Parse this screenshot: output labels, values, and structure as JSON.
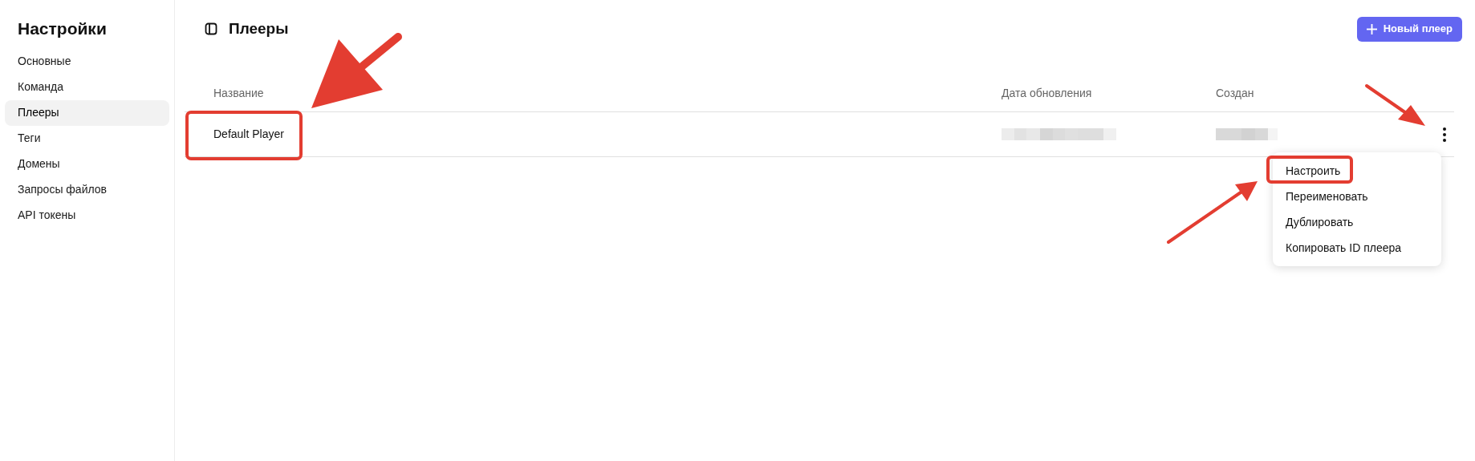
{
  "sidebar": {
    "title": "Настройки",
    "items": [
      {
        "label": "Основные",
        "selected": false
      },
      {
        "label": "Команда",
        "selected": false
      },
      {
        "label": "Плееры",
        "selected": true
      },
      {
        "label": "Теги",
        "selected": false
      },
      {
        "label": "Домены",
        "selected": false
      },
      {
        "label": "Запросы файлов",
        "selected": false
      },
      {
        "label": "API токены",
        "selected": false
      }
    ]
  },
  "page": {
    "title": "Плееры",
    "new_button": "Новый плеер"
  },
  "table": {
    "columns": [
      "Название",
      "Дата обновления",
      "Создан"
    ],
    "rows": [
      {
        "name": "Default Player"
      }
    ]
  },
  "row_menu": {
    "items": [
      "Настроить",
      "Переименовать",
      "Дублировать",
      "Копировать ID плеера"
    ]
  }
}
